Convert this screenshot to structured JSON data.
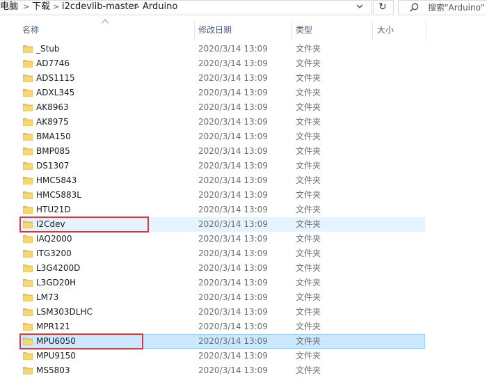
{
  "address": {
    "crumbs": [
      "电脑",
      "下载",
      "i2cdevlib-master",
      "Arduino"
    ],
    "separator": ">",
    "dropdown_glyph": "⌄",
    "refresh_glyph": "↻"
  },
  "search": {
    "placeholder": "搜索\"Arduino\""
  },
  "columns": {
    "name": "名称",
    "modified": "修改日期",
    "type": "类型",
    "size": "大小"
  },
  "rows": [
    {
      "name": "_Stub",
      "date": "2020/3/14 13:09",
      "type": "文件夹"
    },
    {
      "name": "AD7746",
      "date": "2020/3/14 13:09",
      "type": "文件夹"
    },
    {
      "name": "ADS1115",
      "date": "2020/3/14 13:09",
      "type": "文件夹"
    },
    {
      "name": "ADXL345",
      "date": "2020/3/14 13:09",
      "type": "文件夹"
    },
    {
      "name": "AK8963",
      "date": "2020/3/14 13:09",
      "type": "文件夹"
    },
    {
      "name": "AK8975",
      "date": "2020/3/14 13:09",
      "type": "文件夹"
    },
    {
      "name": "BMA150",
      "date": "2020/3/14 13:09",
      "type": "文件夹"
    },
    {
      "name": "BMP085",
      "date": "2020/3/14 13:09",
      "type": "文件夹"
    },
    {
      "name": "DS1307",
      "date": "2020/3/14 13:09",
      "type": "文件夹"
    },
    {
      "name": "HMC5843",
      "date": "2020/3/14 13:09",
      "type": "文件夹"
    },
    {
      "name": "HMC5883L",
      "date": "2020/3/14 13:09",
      "type": "文件夹"
    },
    {
      "name": "HTU21D",
      "date": "2020/3/14 13:09",
      "type": "文件夹"
    },
    {
      "name": "I2Cdev",
      "date": "2020/3/14 13:09",
      "type": "文件夹"
    },
    {
      "name": "IAQ2000",
      "date": "2020/3/14 13:09",
      "type": "文件夹"
    },
    {
      "name": "ITG3200",
      "date": "2020/3/14 13:09",
      "type": "文件夹"
    },
    {
      "name": "L3G4200D",
      "date": "2020/3/14 13:09",
      "type": "文件夹"
    },
    {
      "name": "L3GD20H",
      "date": "2020/3/14 13:09",
      "type": "文件夹"
    },
    {
      "name": "LM73",
      "date": "2020/3/14 13:09",
      "type": "文件夹"
    },
    {
      "name": "LSM303DLHC",
      "date": "2020/3/14 13:09",
      "type": "文件夹"
    },
    {
      "name": "MPR121",
      "date": "2020/3/14 13:09",
      "type": "文件夹"
    },
    {
      "name": "MPU6050",
      "date": "2020/3/14 13:09",
      "type": "文件夹"
    },
    {
      "name": "MPU9150",
      "date": "2020/3/14 13:09",
      "type": "文件夹"
    },
    {
      "name": "MS5803",
      "date": "2020/3/14 13:09",
      "type": "文件夹"
    }
  ],
  "hover_row": "I2Cdev",
  "selected_row": "MPU6050",
  "highlighted_rows": [
    "I2Cdev",
    "MPU6050"
  ],
  "colors": {
    "folder": "#f2c94c",
    "hover_bg": "#e5f3ff",
    "selected_bg": "#cce8ff",
    "annotation_box": "#d43a3f",
    "header_text": "#4c607a"
  }
}
